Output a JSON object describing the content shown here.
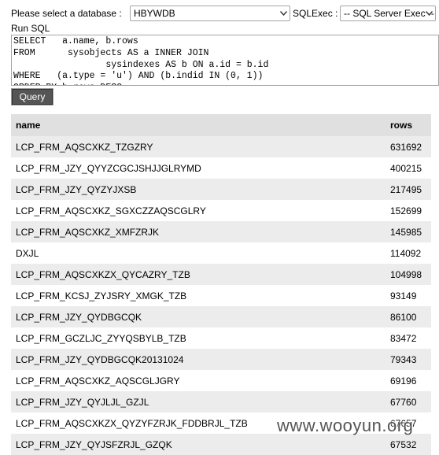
{
  "toolbar": {
    "db_label": "Please select a database :",
    "db_value": "HBYWDB",
    "sqlexec_label": "SQLExec :",
    "sqlexec_value": "-- SQL Server Exec --"
  },
  "run_sql_label": "Run SQL",
  "sql_text": "SELECT   a.name, b.rows\nFROM      sysobjects AS a INNER JOIN\n                 sysindexes AS b ON a.id = b.id\nWHERE   (a.type = 'u') AND (b.indid IN (0, 1))\nORDER BY b.rows DESC",
  "query_button": "Query",
  "table": {
    "headers": [
      "name",
      "rows"
    ],
    "rows": [
      [
        "LCP_FRM_AQSCXKZ_TZGZRY",
        "631692"
      ],
      [
        "LCP_FRM_JZY_QYYZCGCJSHJJGLRYMD",
        "400215"
      ],
      [
        "LCP_FRM_JZY_QYZYJXSB",
        "217495"
      ],
      [
        "LCP_FRM_AQSCXKZ_SGXCZZAQSCGLRY",
        "152699"
      ],
      [
        "LCP_FRM_AQSCXKZ_XMFZRJK",
        "145985"
      ],
      [
        "DXJL",
        "114092"
      ],
      [
        "LCP_FRM_AQSCXKZX_QYCAZRY_TZB",
        "104998"
      ],
      [
        "LCP_FRM_KCSJ_ZYJSRY_XMGK_TZB",
        "93149"
      ],
      [
        "LCP_FRM_JZY_QYDBGCQK",
        "86100"
      ],
      [
        "LCP_FRM_GCZLJC_ZYYQSBYLB_TZB",
        "83472"
      ],
      [
        "LCP_FRM_JZY_QYDBGCQK20131024",
        "79343"
      ],
      [
        "LCP_FRM_AQSCXKZ_AQSCGLJGRY",
        "69196"
      ],
      [
        "LCP_FRM_JZY_QYJLJL_GZJL",
        "67760"
      ],
      [
        "LCP_FRM_AQSCXKZX_QYZYFZRJK_FDDBRJL_TZB",
        "67657"
      ],
      [
        "LCP_FRM_JZY_QYJSFZRJL_GZQK",
        "67532"
      ]
    ]
  },
  "watermark": "www.wooyun.org"
}
